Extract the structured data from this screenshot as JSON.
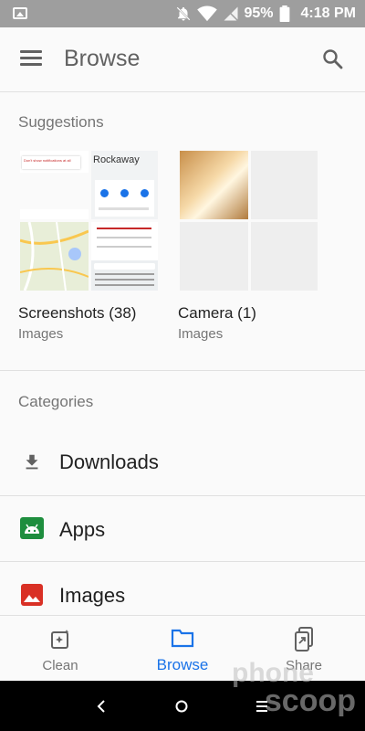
{
  "status_bar": {
    "battery": "95%",
    "time": "4:18 PM"
  },
  "app_bar": {
    "title": "Browse"
  },
  "suggestions": {
    "label": "Suggestions",
    "cards": [
      {
        "title": "Screenshots (38)",
        "subtitle": "Images"
      },
      {
        "title": "Camera (1)",
        "subtitle": "Images"
      }
    ],
    "thumb_text": {
      "notif": "Don't show notifications at all",
      "place": "Rockaway"
    }
  },
  "categories": {
    "label": "Categories",
    "items": [
      {
        "label": "Downloads",
        "icon": "download-icon"
      },
      {
        "label": "Apps",
        "icon": "android-icon",
        "color": "#1e8e3e"
      },
      {
        "label": "Images",
        "icon": "image-icon",
        "color": "#d93025"
      }
    ]
  },
  "bottom_nav": {
    "items": [
      {
        "label": "Clean"
      },
      {
        "label": "Browse",
        "active": true,
        "color": "#1a73e8"
      },
      {
        "label": "Share"
      }
    ]
  },
  "watermark": {
    "line1": "phone",
    "line2": "scoop"
  }
}
